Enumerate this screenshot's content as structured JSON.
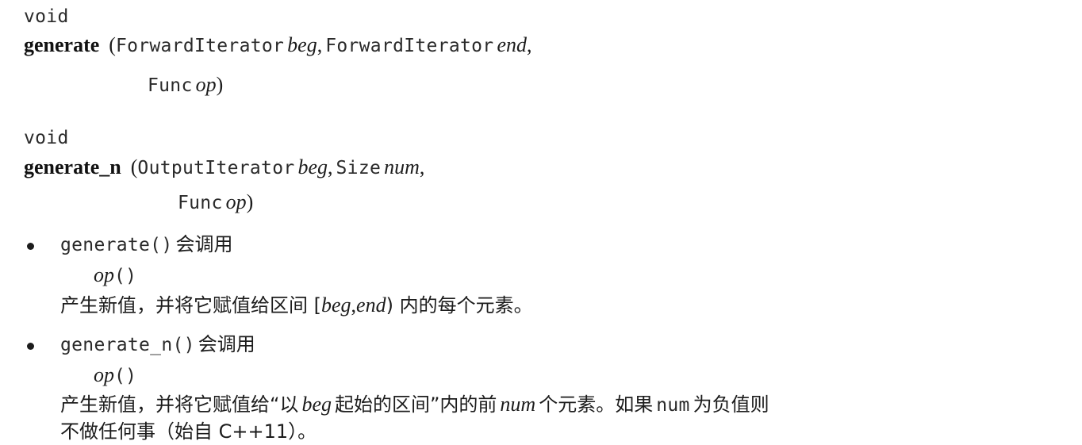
{
  "decl1": {
    "return_type": "void",
    "name": "generate",
    "open_paren": "(",
    "p1_type": "ForwardIterator",
    "p1_name": "beg",
    "comma1": ",",
    "p2_type": "ForwardIterator",
    "p2_name": "end",
    "comma2": ",",
    "p3_type": "Func",
    "p3_name": "op",
    "close_paren": ")"
  },
  "decl2": {
    "return_type": "void",
    "name": "generate_n",
    "open_paren": "(",
    "p1_type": "OutputIterator",
    "p1_name": "beg",
    "comma1": ",",
    "p2_type": "Size",
    "p2_name": "num",
    "comma2": ",",
    "p3_type": "Func",
    "p3_name": "op",
    "close_paren": ")"
  },
  "bullet1": {
    "func": "generate()",
    "calls": "会调用",
    "op_name": "op",
    "op_parens": "()",
    "desc_a": "产生新值，并将它赋值给区间 [",
    "desc_beg": "beg",
    "desc_comma": ",",
    "desc_end": "end",
    "desc_b": ") 内的每个元素。"
  },
  "bullet2": {
    "func": "generate_n()",
    "calls": "会调用",
    "op_name": "op",
    "op_parens": "()",
    "desc_a": "产生新值，并将它赋值给“以",
    "desc_beg": "beg",
    "desc_b": "起始的区间”内的前",
    "desc_num": "num",
    "desc_c": "个元素。如果",
    "desc_num_code": "num",
    "desc_d": "为负值则",
    "desc_line2": "不做任何事（始自 C++11）。"
  }
}
